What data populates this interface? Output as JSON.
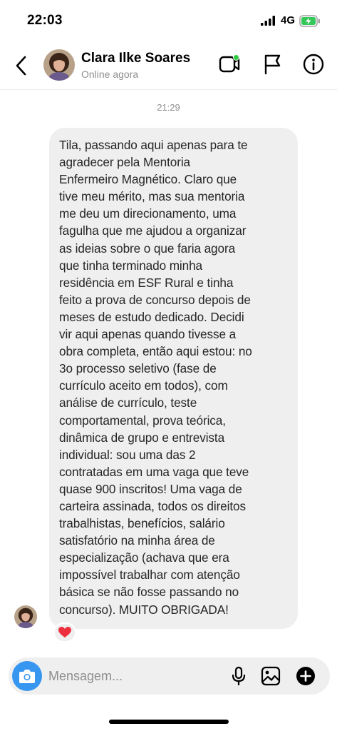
{
  "status_bar": {
    "time": "22:03",
    "network": "4G"
  },
  "header": {
    "contact_name": "Clara Ilke Soares",
    "contact_status": "Online agora",
    "icons": [
      "back-icon",
      "video-call-icon",
      "flag-icon",
      "info-icon"
    ]
  },
  "conversation": {
    "timestamp": "21:29",
    "message": "Tila, passando aqui apenas para te\nagradecer pela Mentoria\nEnfermeiro Magnético. Claro que\ntive meu mérito, mas sua mentoria\nme deu um direcionamento, uma\nfagulha que me ajudou a organizar\nas ideias sobre o que faria agora\nque tinha terminado minha\nresidência em ESF Rural e tinha\nfeito a prova de concurso depois de\nmeses de estudo dedicado. Decidi\nvir aqui apenas quando tivesse a\nobra completa, então aqui estou: no\n3o processo seletivo (fase de\ncurrículo aceito em todos), com\nanálise de currículo, teste\ncomportamental, prova teórica,\ndinâmica de grupo e entrevista\nindividual: sou uma das 2\ncontratadas em uma vaga que teve\nquase 900 inscritos! Uma vaga de\ncarteira assinada, todos os direitos\ntrabalhistas, benefícios, salário\nsatisfatório na minha área de\nespecialização (achava que era\nimpossível trabalhar com atenção\nbásica se não fosse passando no\nconcurso). MUITO OBRIGADA!",
    "reaction": "❤️"
  },
  "composer": {
    "placeholder": "Mensagem...",
    "icons": [
      "camera-icon",
      "microphone-icon",
      "gallery-icon",
      "plus-icon"
    ]
  },
  "colors": {
    "accent": "#3797f0",
    "bubble": "#efefef",
    "online": "#2ecc40",
    "muted_text": "#8e8e8e"
  }
}
